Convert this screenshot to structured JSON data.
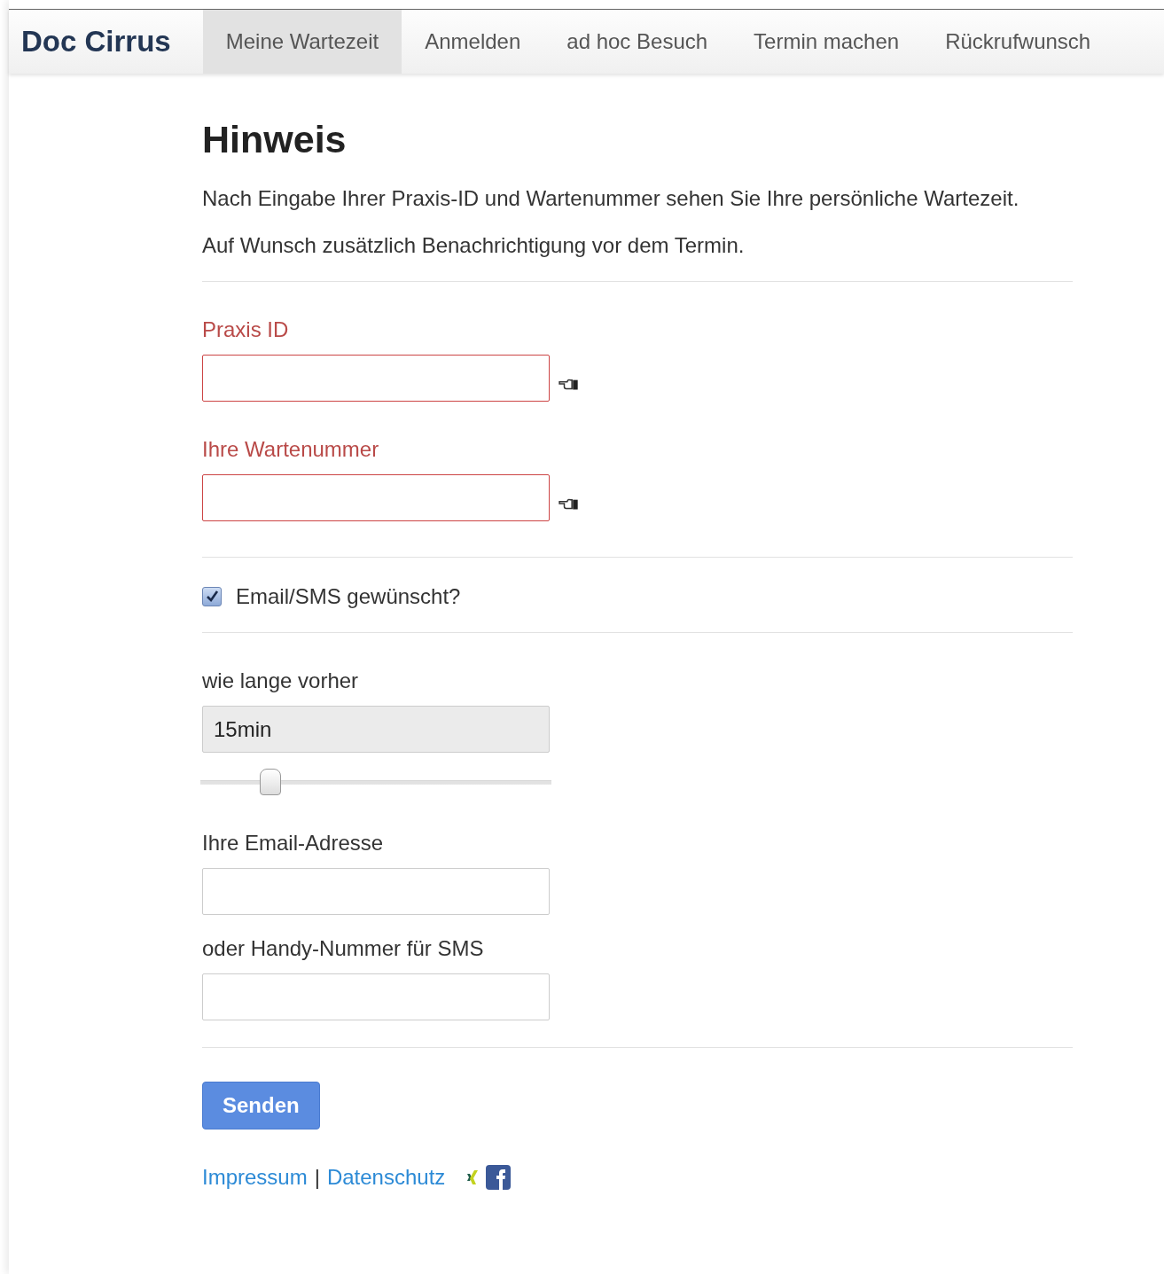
{
  "brand": "Doc Cirrus",
  "nav": [
    {
      "label": "Meine Wartezeit",
      "selected": true
    },
    {
      "label": "Anmelden",
      "selected": false
    },
    {
      "label": "ad hoc Besuch",
      "selected": false
    },
    {
      "label": "Termin machen",
      "selected": false
    },
    {
      "label": "Rückrufwunsch",
      "selected": false
    }
  ],
  "heading": "Hinweis",
  "intro": [
    "Nach Eingabe Ihrer Praxis-ID und Wartenummer sehen Sie Ihre persönliche Wartezeit.",
    "Auf Wunsch zusätzlich Benachrichtigung vor dem Termin."
  ],
  "required_fields": [
    {
      "label": "Praxis ID",
      "error": true
    },
    {
      "label": "Ihre Wartenummer",
      "error": true
    }
  ],
  "notify": {
    "label": "Email/SMS gewünscht?",
    "checked": true
  },
  "lead_time": {
    "label": "wie lange vorher",
    "value": "15min",
    "level": 0.2
  },
  "contact_fields": [
    {
      "label": "Ihre Email-Adresse",
      "error": false
    },
    {
      "label": "oder Handy-Nummer für SMS",
      "error": false
    }
  ],
  "submit": "Senden",
  "footer_links": [
    "Impressum",
    "Datenschutz"
  ],
  "footer_separator": "|"
}
